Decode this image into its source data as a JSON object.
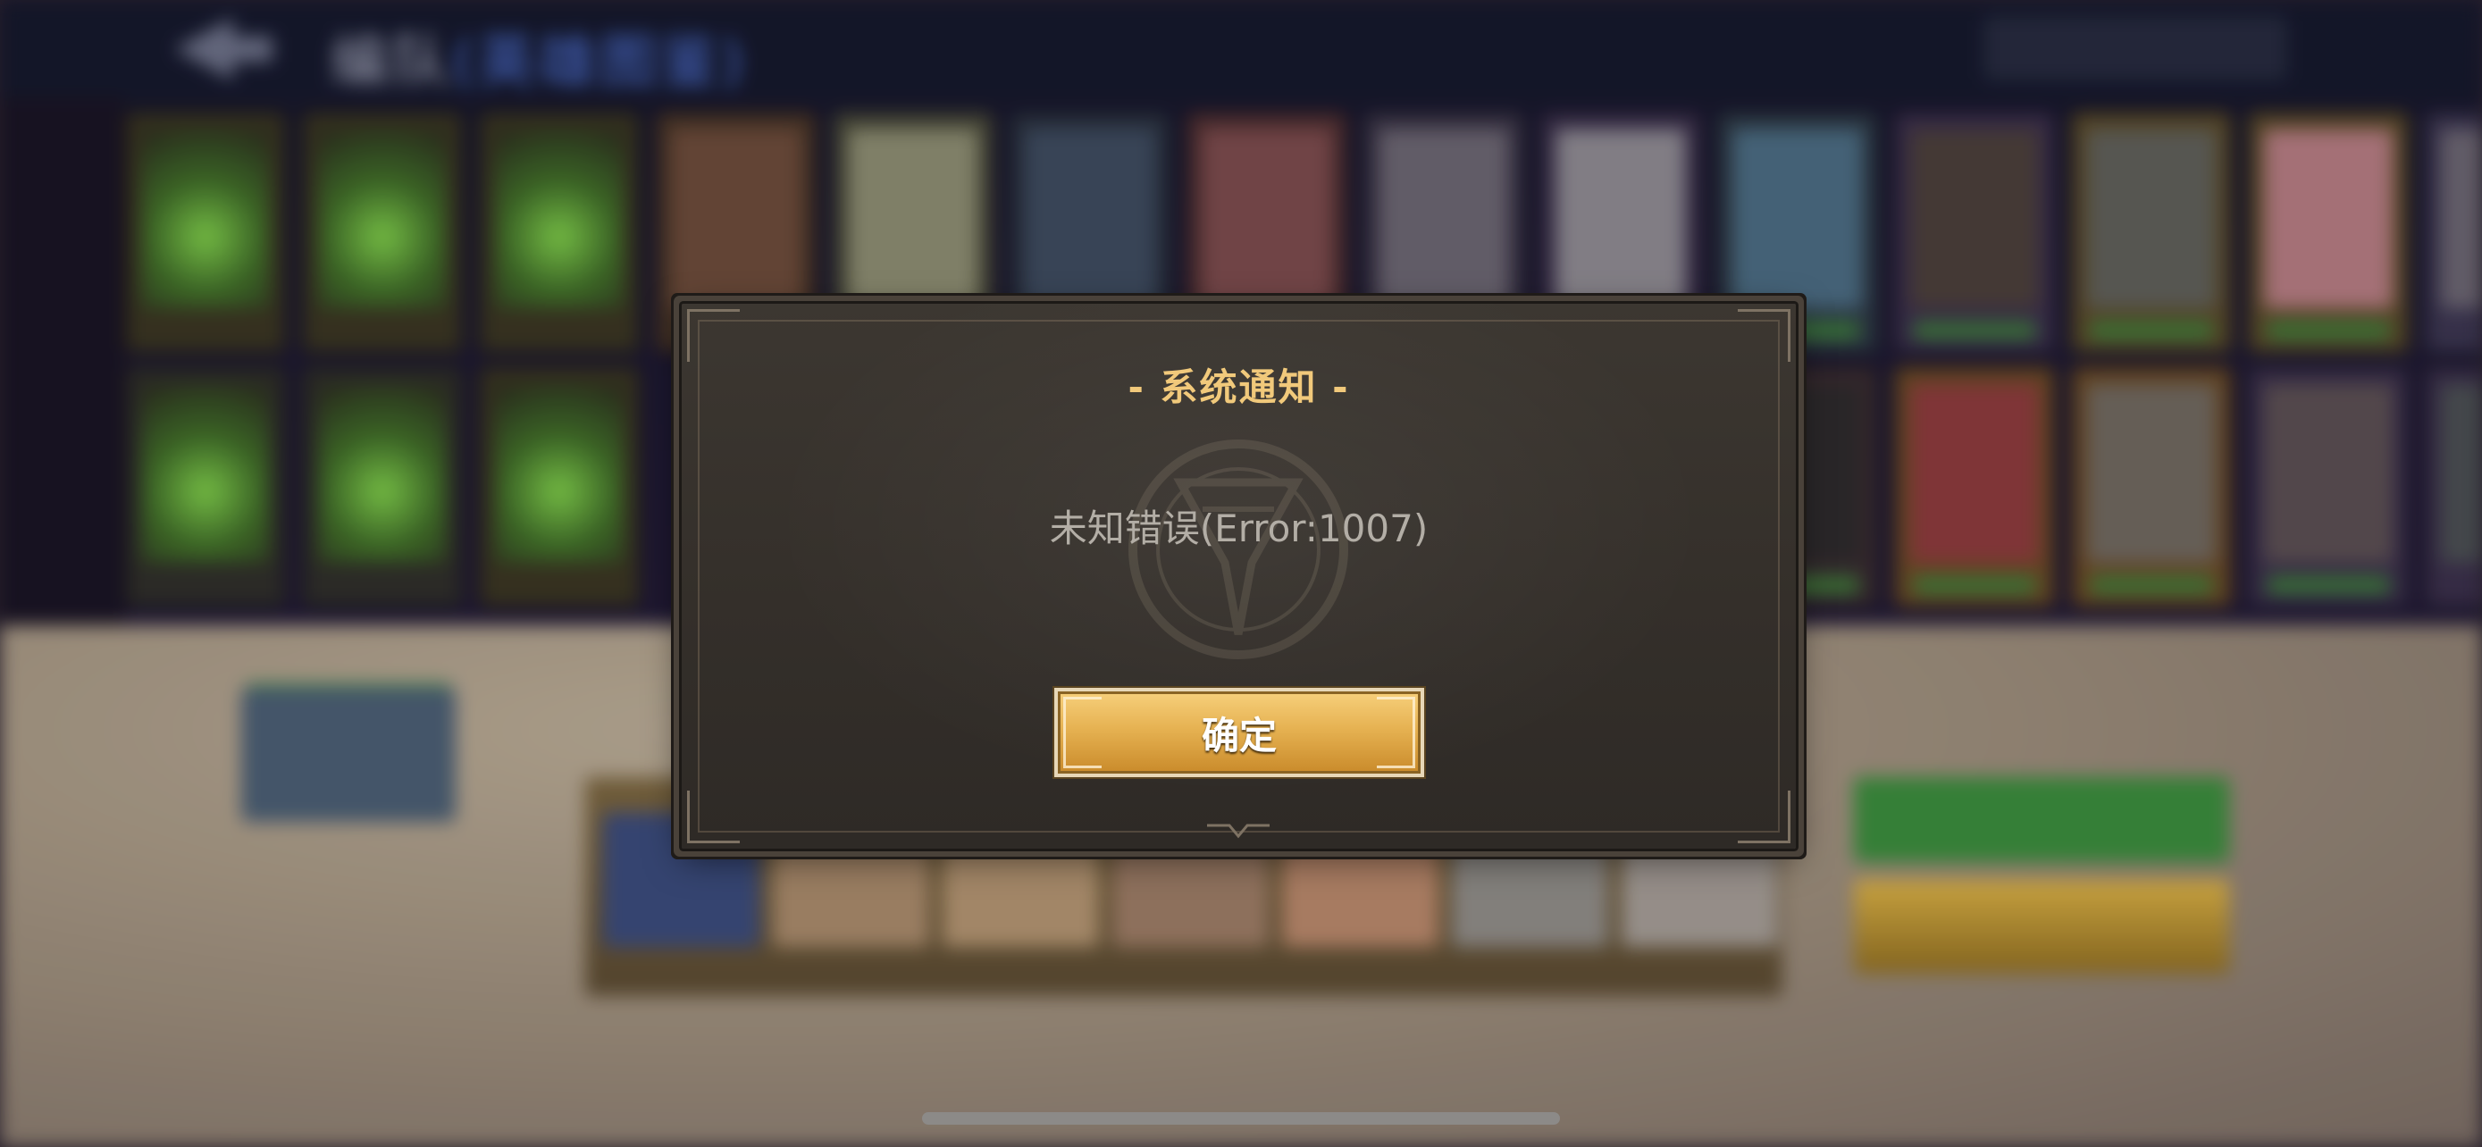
{
  "background_scene": {
    "header_title": "编队",
    "header_title_highlight": "(英雄图鉴)"
  },
  "dialog": {
    "title": "- 系统通知 -",
    "message": "未知错误(Error:1007)",
    "confirm_label": "确定"
  },
  "colors": {
    "title_gold": "#f1c97b",
    "message_gray": "#b3aea6",
    "button_gold": "#e6b252",
    "dialog_bg": "#36312b"
  }
}
